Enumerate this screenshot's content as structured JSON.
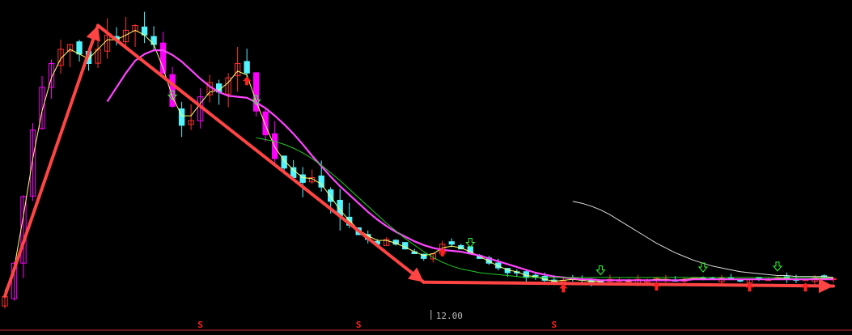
{
  "chart_data": {
    "type": "candlestick",
    "title": "",
    "xlabel": "",
    "ylabel": "",
    "grid": false,
    "legend": "none",
    "colors": {
      "background": "#000000",
      "up_candle": "#ff3030",
      "down_candle": "#54f4ff",
      "big_candle": "#ff00ff",
      "ma_short": "#ffff66",
      "ma_mid": "#ff44ff",
      "ma_long": "#22cc22",
      "ma_longest": "#dddddd",
      "trend_arrow": "#ff4444",
      "signal_up": "#ff2222",
      "signal_down": "#33ff33",
      "axis_line": "#c03030",
      "label": "#bbbbbb"
    },
    "annotations": {
      "price_label": "12.00",
      "dividend_marker": "S"
    },
    "series": [
      {
        "id": "close",
        "values": [
          13.5,
          17.0,
          24.0,
          31.0,
          35.5,
          38.0,
          39.5,
          40.0,
          39.0,
          38.0,
          39.5,
          41.0,
          40.5,
          41.5,
          42.0,
          41.0,
          40.0,
          37.0,
          33.5,
          31.5,
          32.0,
          34.5,
          36.0,
          35.0,
          36.5,
          38.0,
          37.0,
          33.0,
          30.5,
          28.0,
          27.0,
          26.0,
          25.5,
          26.0,
          25.0,
          23.5,
          22.0,
          21.0,
          20.0,
          19.5,
          19.0,
          19.5,
          19.0,
          18.5,
          18.0,
          17.5,
          18.0,
          19.0,
          19.0,
          18.5,
          18.0,
          17.5,
          17.0,
          16.5,
          16.0,
          16.0,
          15.5,
          15.5,
          15.2,
          15.0,
          15.2,
          15.4,
          15.2,
          15.0,
          15.1,
          15.3,
          15.2,
          15.1,
          15.3,
          15.2,
          15.4,
          15.3,
          15.2,
          15.3,
          15.5,
          15.4,
          15.3,
          15.4,
          15.3,
          15.2,
          15.3,
          15.4,
          15.3,
          15.5,
          15.4,
          15.3,
          15.3,
          15.4,
          15.5,
          15.4
        ]
      },
      {
        "id": "ma_short",
        "values": [
          14.0,
          16.5,
          22.0,
          28.0,
          33.0,
          36.5,
          38.5,
          39.5,
          39.0,
          38.5,
          39.5,
          40.5,
          40.5,
          41.0,
          41.5,
          41.0,
          40.0,
          37.5,
          34.5,
          32.5,
          32.5,
          33.8,
          35.0,
          35.2,
          36.0,
          37.2,
          36.8,
          34.0,
          31.5,
          29.2,
          27.8,
          26.8,
          26.0,
          25.9,
          25.3,
          24.0,
          22.6,
          21.5,
          20.5,
          19.9,
          19.4,
          19.4,
          19.1,
          18.7,
          18.2,
          17.8,
          18.0,
          18.6,
          18.8,
          18.6,
          18.2,
          17.7,
          17.2,
          16.7,
          16.3,
          16.1,
          15.7,
          15.6,
          15.3,
          15.1,
          15.2,
          15.3,
          15.2,
          15.1,
          15.1,
          15.2,
          15.2,
          15.1,
          15.2,
          15.2,
          15.3,
          15.3,
          15.2,
          15.3,
          15.4,
          15.4,
          15.3,
          15.4,
          15.3,
          15.3,
          15.3,
          15.3,
          15.3,
          15.4,
          15.4,
          15.3,
          15.3,
          15.4,
          15.4,
          15.4
        ]
      },
      {
        "id": "ma_mid",
        "values": [
          null,
          null,
          null,
          null,
          null,
          null,
          null,
          null,
          null,
          null,
          null,
          34.0,
          35.5,
          37.0,
          38.3,
          39.0,
          39.4,
          39.4,
          38.9,
          38.2,
          37.3,
          36.4,
          35.6,
          35.0,
          34.6,
          34.5,
          34.4,
          33.9,
          33.3,
          32.5,
          31.6,
          30.6,
          29.5,
          28.3,
          27.2,
          26.1,
          25.1,
          24.2,
          23.3,
          22.4,
          21.6,
          20.9,
          20.3,
          19.8,
          19.3,
          18.9,
          18.6,
          18.4,
          18.3,
          18.2,
          18.0,
          17.8,
          17.5,
          17.2,
          16.9,
          16.6,
          16.3,
          16.0,
          15.8,
          15.6,
          15.5,
          15.4,
          15.3,
          15.3,
          15.2,
          15.2,
          15.2,
          15.2,
          15.2,
          15.2,
          15.2,
          15.2,
          15.2,
          15.2,
          15.3,
          15.3,
          15.3,
          15.3,
          15.3,
          15.3,
          15.3,
          15.3,
          15.3,
          15.3,
          15.3,
          15.3,
          15.3,
          15.3,
          15.3,
          15.3
        ]
      },
      {
        "id": "ma_long",
        "values": [
          null,
          null,
          null,
          null,
          null,
          null,
          null,
          null,
          null,
          null,
          null,
          null,
          null,
          null,
          null,
          null,
          null,
          null,
          null,
          null,
          null,
          null,
          null,
          null,
          null,
          null,
          null,
          30.2,
          30.0,
          29.8,
          29.5,
          29.1,
          28.6,
          28.0,
          27.3,
          26.5,
          25.7,
          24.8,
          23.9,
          23.0,
          22.1,
          21.2,
          20.4,
          19.6,
          18.9,
          18.2,
          17.6,
          17.1,
          16.7,
          16.4,
          16.2,
          16.0,
          15.9,
          15.8,
          15.7,
          15.6,
          15.5,
          15.5,
          15.5,
          15.5,
          15.5,
          15.5,
          15.5,
          15.5,
          15.5,
          15.5,
          15.5,
          15.5,
          15.5,
          15.5,
          15.5,
          15.5,
          15.5,
          15.5,
          15.5,
          15.5,
          15.5,
          15.5,
          15.5,
          15.5,
          15.5,
          15.5,
          15.5,
          15.5,
          15.5,
          15.5,
          15.5,
          15.5,
          15.5,
          15.5
        ]
      },
      {
        "id": "ma_longest",
        "values": [
          null,
          null,
          null,
          null,
          null,
          null,
          null,
          null,
          null,
          null,
          null,
          null,
          null,
          null,
          null,
          null,
          null,
          null,
          null,
          null,
          null,
          null,
          null,
          null,
          null,
          null,
          null,
          null,
          null,
          null,
          null,
          null,
          null,
          null,
          null,
          null,
          null,
          null,
          null,
          null,
          null,
          null,
          null,
          null,
          null,
          null,
          null,
          null,
          null,
          null,
          null,
          null,
          null,
          null,
          null,
          null,
          null,
          null,
          null,
          null,
          null,
          23.5,
          23.3,
          23.0,
          22.6,
          22.1,
          21.5,
          20.9,
          20.3,
          19.7,
          19.1,
          18.6,
          18.1,
          17.7,
          17.3,
          17.0,
          16.7,
          16.5,
          16.3,
          16.1,
          16.0,
          15.9,
          15.8,
          15.7,
          15.7,
          15.6,
          15.6,
          15.6,
          15.6,
          15.5
        ]
      }
    ],
    "trend_lines": [
      {
        "from": [
          0,
          13.5
        ],
        "to": [
          10,
          42.0
        ]
      },
      {
        "from": [
          10,
          42.0
        ],
        "to": [
          45,
          15.0
        ]
      },
      {
        "from": [
          45,
          15.0
        ],
        "to": [
          89,
          14.6
        ]
      }
    ],
    "signals": [
      {
        "index": 18,
        "kind": "down"
      },
      {
        "index": 26,
        "kind": "up"
      },
      {
        "index": 27,
        "kind": "down"
      },
      {
        "index": 47,
        "kind": "up"
      },
      {
        "index": 50,
        "kind": "down"
      },
      {
        "index": 60,
        "kind": "up"
      },
      {
        "index": 64,
        "kind": "down"
      },
      {
        "index": 70,
        "kind": "up"
      },
      {
        "index": 75,
        "kind": "down"
      },
      {
        "index": 80,
        "kind": "up"
      },
      {
        "index": 83,
        "kind": "down"
      },
      {
        "index": 86,
        "kind": "up"
      }
    ],
    "markers_at": [
      21,
      38,
      59
    ],
    "price_label_at": 47,
    "ylim": [
      12,
      44
    ]
  }
}
